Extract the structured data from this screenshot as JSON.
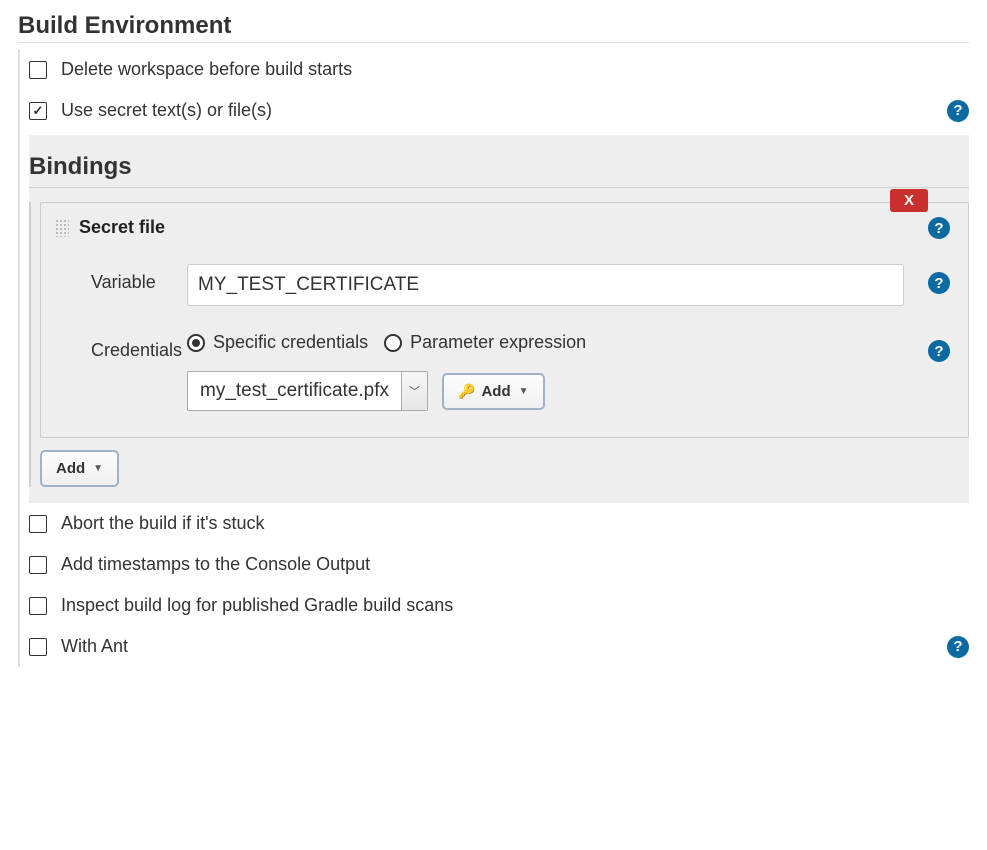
{
  "section_heading": "Build Environment",
  "checkboxes_top": [
    {
      "label": "Delete workspace before build starts",
      "checked": false,
      "help": false
    },
    {
      "label": "Use secret text(s) or file(s)",
      "checked": true,
      "help": true
    }
  ],
  "bindings_heading": "Bindings",
  "binding": {
    "title": "Secret file",
    "delete_label": "X",
    "variable_label": "Variable",
    "variable_value": "MY_TEST_CERTIFICATE",
    "credentials_label": "Credentials",
    "radio_options": [
      {
        "label": "Specific credentials",
        "selected": true
      },
      {
        "label": "Parameter expression",
        "selected": false
      }
    ],
    "credential_select_value": "my_test_certificate.pfx",
    "add_cred_label": "Add"
  },
  "bindings_add_label": "Add",
  "checkboxes_bottom": [
    {
      "label": "Abort the build if it's stuck",
      "checked": false,
      "help": false
    },
    {
      "label": "Add timestamps to the Console Output",
      "checked": false,
      "help": false
    },
    {
      "label": "Inspect build log for published Gradle build scans",
      "checked": false,
      "help": false
    },
    {
      "label": "With Ant",
      "checked": false,
      "help": true
    }
  ],
  "help_glyph": "?",
  "caret_glyph": "▼",
  "key_glyph": "🔑"
}
